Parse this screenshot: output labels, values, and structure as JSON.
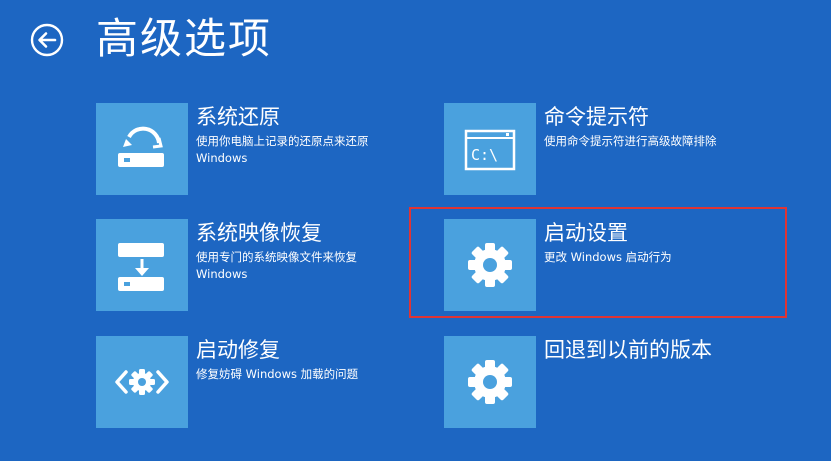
{
  "page": {
    "title": "高级选项"
  },
  "options": [
    {
      "id": "system-restore",
      "title": "系统还原",
      "description": "使用你电脑上记录的还原点来还原 Windows",
      "icon": "system-restore-icon"
    },
    {
      "id": "command-prompt",
      "title": "命令提示符",
      "description": "使用命令提示符进行高级故障排除",
      "icon": "command-prompt-icon",
      "icon_text": "C:\\"
    },
    {
      "id": "system-image-recovery",
      "title": "系统映像恢复",
      "description": "使用专门的系统映像文件来恢复 Windows",
      "icon": "disk-image-icon"
    },
    {
      "id": "startup-settings",
      "title": "启动设置",
      "description": "更改 Windows 启动行为",
      "icon": "gear-icon"
    },
    {
      "id": "startup-repair",
      "title": "启动修复",
      "description": "修复妨碍 Windows 加载的问题",
      "icon": "repair-gear-icon"
    },
    {
      "id": "go-back",
      "title": "回退到以前的版本",
      "description": "",
      "icon": "gear-icon"
    }
  ],
  "colors": {
    "background": "#1d66c2",
    "tile": "#4aa1de",
    "highlight": "#e03434"
  }
}
